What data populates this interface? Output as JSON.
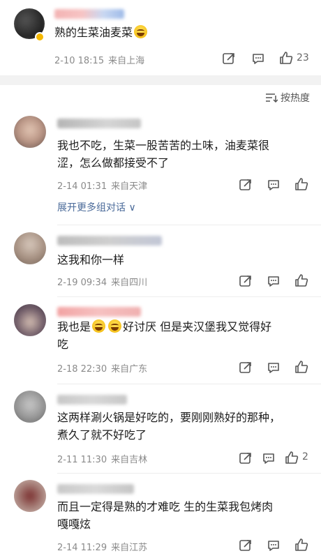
{
  "post": {
    "text": "熟的生菜油麦菜",
    "time": "2-10 18:15",
    "source": "来自上海",
    "like_count": "23",
    "emoji": "crying-laughing"
  },
  "sort": {
    "label": "按热度",
    "icon": "sort-icon"
  },
  "comments": [
    {
      "line1": "我也不吃，生菜一股苦苦的土味，油麦菜很",
      "line2": "涩，怎么做都接受不了",
      "time": "2-14 01:31",
      "source": "来自天津",
      "like_count": ""
    },
    {
      "line1": "这我和你一样",
      "time": "2-19 09:34",
      "source": "来自四川",
      "like_count": ""
    },
    {
      "line1_a": "我也是",
      "line1_b": "好讨厌  但是夹汉堡我又觉得好",
      "line2": "吃",
      "time": "2-18 22:30",
      "source": "来自广东",
      "like_count": ""
    },
    {
      "line1": "这两样涮火锅是好吃的，要刚刚熟好的那种，",
      "line2": "煮久了就不好吃了",
      "time": "2-11 11:30",
      "source": "来自吉林",
      "like_count": "2"
    },
    {
      "line1": "而且一定得是熟的才难吃 生的生菜我包烤肉",
      "line2": "嘎嘎炫",
      "time": "2-14 11:29",
      "source": "来自江苏",
      "like_count": ""
    }
  ],
  "expand_replies": "展开更多组对话 ∨",
  "colors": {
    "accent_link": "#4a6a99",
    "meta_gray": "#8a8a8a",
    "divider": "#f2f2f2"
  }
}
